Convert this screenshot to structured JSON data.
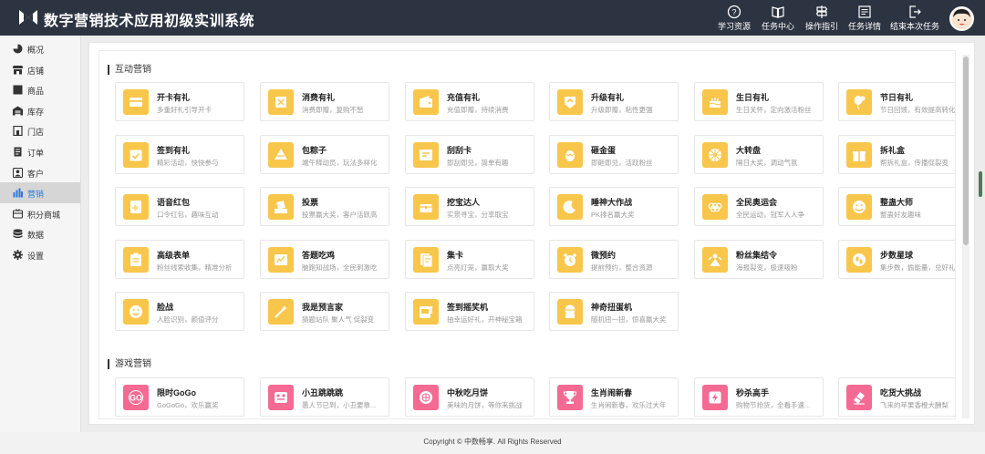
{
  "app": {
    "title": "数字营销技术应用初级实训系统"
  },
  "header_actions": [
    {
      "label": "学习资源",
      "icon": "help-circle-icon"
    },
    {
      "label": "任务中心",
      "icon": "book-icon"
    },
    {
      "label": "操作指引",
      "icon": "signpost-icon"
    },
    {
      "label": "任务详情",
      "icon": "list-icon"
    },
    {
      "label": "结束本次任务",
      "icon": "exit-icon"
    }
  ],
  "sidebar": {
    "items": [
      {
        "label": "概况",
        "icon": "pie-chart-icon"
      },
      {
        "label": "店铺",
        "icon": "store-icon"
      },
      {
        "label": "商品",
        "icon": "product-icon"
      },
      {
        "label": "库存",
        "icon": "warehouse-icon"
      },
      {
        "label": "门店",
        "icon": "shop-door-icon"
      },
      {
        "label": "订单",
        "icon": "order-icon"
      },
      {
        "label": "客户",
        "icon": "customer-icon"
      },
      {
        "label": "营销",
        "icon": "bar-chart-icon",
        "active": true
      },
      {
        "label": "积分商城",
        "icon": "points-mall-icon"
      },
      {
        "label": "数据",
        "icon": "database-icon"
      },
      {
        "label": "设置",
        "icon": "gear-icon"
      }
    ]
  },
  "sections": {
    "interactive": {
      "title": "互动营销",
      "cards": [
        {
          "title": "开卡有礼",
          "desc": "多重好礼引导开卡",
          "icon": "membership-card-icon"
        },
        {
          "title": "消费有礼",
          "desc": "消费即赠，复购不愁",
          "icon": "shopping-gift-icon"
        },
        {
          "title": "充值有礼",
          "desc": "充值即赠，持续消费",
          "icon": "wallet-icon"
        },
        {
          "title": "升级有礼",
          "desc": "升级即赠，粘性更强",
          "icon": "level-up-icon"
        },
        {
          "title": "生日有礼",
          "desc": "生日关怀，定向激活粉丝",
          "icon": "birthday-cake-icon"
        },
        {
          "title": "节日有礼",
          "desc": "节日回馈，有效提高转化",
          "icon": "balloon-icon"
        },
        {
          "title": "签到有礼",
          "desc": "精彩活动，快快参与",
          "icon": "calendar-check-icon"
        },
        {
          "title": "包粽子",
          "desc": "端午释动员，玩法多样化",
          "icon": "zongzi-icon"
        },
        {
          "title": "刮刮卡",
          "desc": "即刮即兑，简单有趣",
          "icon": "scratch-card-icon"
        },
        {
          "title": "砸金蛋",
          "desc": "即砸即兑，活跃粉丝",
          "icon": "golden-egg-icon"
        },
        {
          "title": "大转盘",
          "desc": "隔日大奖，调动气氛",
          "icon": "wheel-icon"
        },
        {
          "title": "拆礼盒",
          "desc": "帮拆礼盒，传播促裂变",
          "icon": "gift-box-icon"
        },
        {
          "title": "语音红包",
          "desc": "口令红包，趣味互动",
          "icon": "voice-envelope-icon"
        },
        {
          "title": "投票",
          "desc": "投票赢大奖，客户活跃高",
          "icon": "vote-icon"
        },
        {
          "title": "挖宝达人",
          "desc": "实景寻宝，分享取宝",
          "icon": "treasure-icon"
        },
        {
          "title": "睡神大作战",
          "desc": "PK排名赢大奖",
          "icon": "moon-icon"
        },
        {
          "title": "全民奥运会",
          "desc": "全民运动，冠军人人争",
          "icon": "olympic-rings-icon"
        },
        {
          "title": "整蛊大师",
          "desc": "整蛊好友趣味",
          "icon": "prank-face-icon"
        },
        {
          "title": "高级表单",
          "desc": "粉丝线索收集，精准分析",
          "icon": "clipboard-icon"
        },
        {
          "title": "答题吃鸡",
          "desc": "脑跑知战场，全民刺激吃",
          "icon": "quiz-icon"
        },
        {
          "title": "集卡",
          "desc": "点亮灯笼，赢取大奖",
          "icon": "card-collect-icon"
        },
        {
          "title": "微预约",
          "desc": "提前预约，整合资源",
          "icon": "alarm-clock-icon"
        },
        {
          "title": "粉丝集结令",
          "desc": "海报裂变，极速吸粉",
          "icon": "crowd-icon"
        },
        {
          "title": "步数星球",
          "desc": "集步数，偷能量，兑好礼",
          "icon": "footsteps-icon"
        },
        {
          "title": "脸战",
          "desc": "人脸识别，颜值评分",
          "icon": "smile-face-icon"
        },
        {
          "title": "我是预言家",
          "desc": "猜题站队 聚人气 促裂变",
          "icon": "magic-wand-icon"
        },
        {
          "title": "签到摇奖机",
          "desc": "抽幸运好礼，开神秘宝箱",
          "icon": "slot-machine-icon"
        },
        {
          "title": "神奇扭蛋机",
          "desc": "随机扭一扭，惊喜赢大奖",
          "icon": "capsule-toy-icon"
        }
      ]
    },
    "games": {
      "title": "游戏营销",
      "cards": [
        {
          "title": "限时GoGo",
          "desc": "GoGoGo，欢乐赢奖",
          "icon": "go-icon"
        },
        {
          "title": "小丑跳跳跳",
          "desc": "愚人节已到，小丑要靠...",
          "icon": "clown-icon"
        },
        {
          "title": "中秋吃月饼",
          "desc": "美味的月饼，等你来挑战",
          "icon": "mooncake-icon"
        },
        {
          "title": "生肖闹新春",
          "desc": "生肖闹新春，欢乐过大年",
          "icon": "trophy-icon"
        },
        {
          "title": "秒杀高手",
          "desc": "购物节抢货，全看手速...",
          "icon": "flash-sale-icon"
        },
        {
          "title": "吃货大挑战",
          "desc": "飞来的苹果香橙大酬梨",
          "icon": "eraser-icon"
        }
      ]
    }
  },
  "footer": {
    "text": "Copyright © 中数畅享. All Rights Reserved"
  },
  "colors": {
    "header_bg": "#2c3442",
    "card_icon_yellow": "#f8c64b",
    "card_icon_pink": "#f46a93",
    "active_link": "#2f7bd9"
  }
}
